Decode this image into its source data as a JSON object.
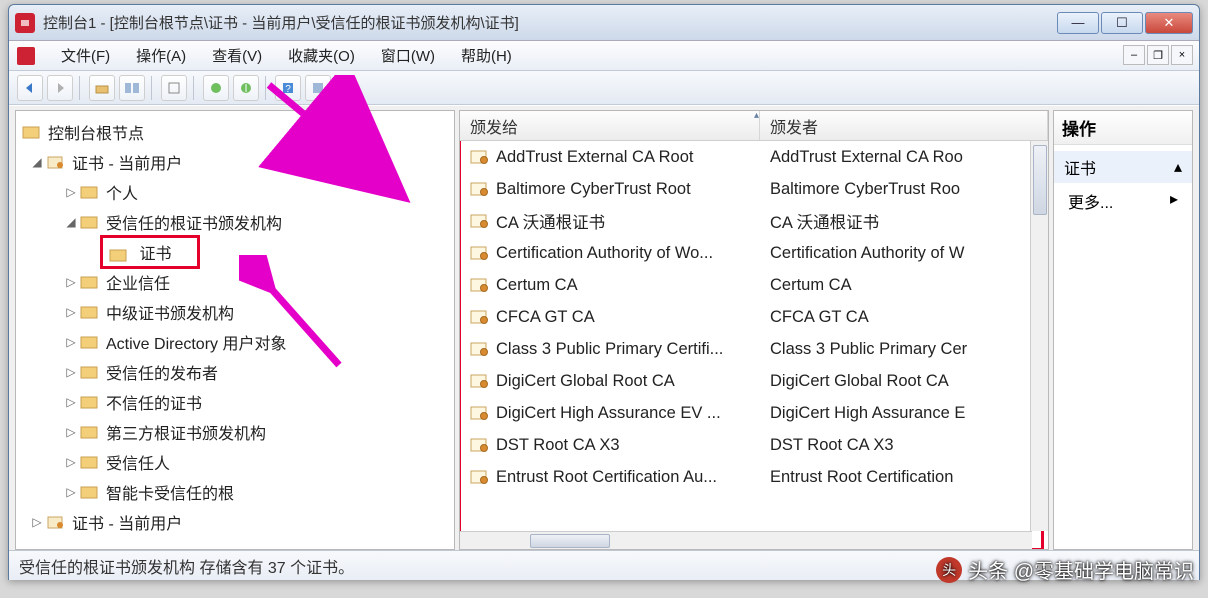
{
  "window": {
    "title": "控制台1 - [控制台根节点\\证书 - 当前用户\\受信任的根证书颁发机构\\证书]"
  },
  "menu": {
    "file": "文件(F)",
    "action": "操作(A)",
    "view": "查看(V)",
    "favorites": "收藏夹(O)",
    "window": "窗口(W)",
    "help": "帮助(H)"
  },
  "tree": {
    "root": "控制台根节点",
    "certUser": "证书 - 当前用户",
    "personal": "个人",
    "trustedRoot": "受信任的根证书颁发机构",
    "certs": "证书",
    "enterprise": "企业信任",
    "intermediate": "中级证书颁发机构",
    "ad": "Active Directory 用户对象",
    "trustedPub": "受信任的发布者",
    "untrusted": "不信任的证书",
    "thirdParty": "第三方根证书颁发机构",
    "trustedPeople": "受信任人",
    "smartcard": "智能卡受信任的根",
    "certUser2": "证书 - 当前用户"
  },
  "columns": {
    "issuedTo": "颁发给",
    "issuedBy": "颁发者"
  },
  "rows": [
    {
      "to": "AddTrust External CA Root",
      "by": "AddTrust External CA Roo"
    },
    {
      "to": "Baltimore CyberTrust Root",
      "by": "Baltimore CyberTrust Roo"
    },
    {
      "to": "CA 沃通根证书",
      "by": "CA 沃通根证书"
    },
    {
      "to": "Certification Authority of Wo...",
      "by": "Certification Authority of W"
    },
    {
      "to": "Certum CA",
      "by": "Certum CA"
    },
    {
      "to": "CFCA GT CA",
      "by": "CFCA GT CA"
    },
    {
      "to": "Class 3 Public Primary Certifi...",
      "by": "Class 3 Public Primary Cer"
    },
    {
      "to": "DigiCert Global Root CA",
      "by": "DigiCert Global Root CA"
    },
    {
      "to": "DigiCert High Assurance EV ...",
      "by": "DigiCert High Assurance E"
    },
    {
      "to": "DST Root CA X3",
      "by": "DST Root CA X3"
    },
    {
      "to": "Entrust Root Certification Au...",
      "by": "Entrust Root Certification"
    }
  ],
  "actions": {
    "header": "操作",
    "group": "证书",
    "more": "更多..."
  },
  "status": "受信任的根证书颁发机构 存储含有 37 个证书。",
  "watermark": "头条 @零基础学电脑常识"
}
